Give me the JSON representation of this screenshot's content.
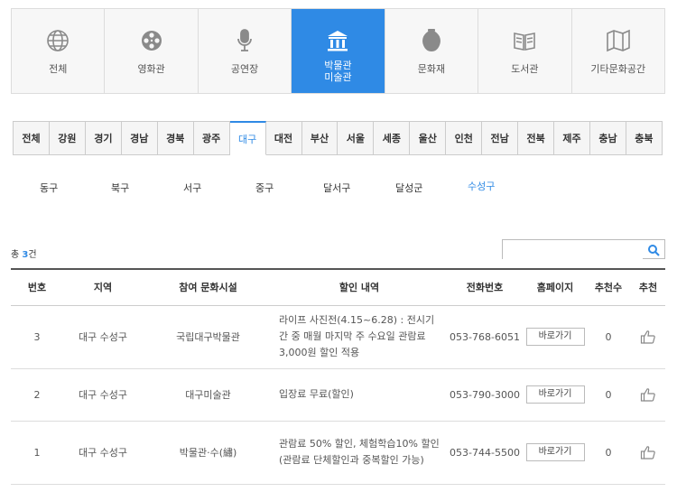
{
  "categories": [
    {
      "label": "전체",
      "icon": "globe-icon"
    },
    {
      "label": "영화관",
      "icon": "film-reel-icon"
    },
    {
      "label": "공연장",
      "icon": "microphone-icon"
    },
    {
      "label": "박물관\n미술관",
      "icon": "museum-icon",
      "active": true
    },
    {
      "label": "문화재",
      "icon": "vase-icon"
    },
    {
      "label": "도서관",
      "icon": "book-icon"
    },
    {
      "label": "기타문화공간",
      "icon": "map-icon"
    }
  ],
  "regions": [
    "전체",
    "강원",
    "경기",
    "경남",
    "경북",
    "광주",
    "대구",
    "대전",
    "부산",
    "서울",
    "세종",
    "울산",
    "인천",
    "전남",
    "전북",
    "제주",
    "충남",
    "충북"
  ],
  "active_region": "대구",
  "districts": [
    "동구",
    "북구",
    "서구",
    "중구",
    "달서구",
    "달성군",
    "수성구"
  ],
  "active_district": "수성구",
  "count": {
    "prefix": "총 ",
    "number": "3",
    "suffix": "건"
  },
  "search": {
    "placeholder": "",
    "value": ""
  },
  "table": {
    "headers": [
      "번호",
      "지역",
      "참여 문화시설",
      "할인 내역",
      "전화번호",
      "홈페이지",
      "추천수",
      "추천"
    ],
    "rows": [
      {
        "no": "3",
        "region": "대구 수성구",
        "facility": "국립대구박물관",
        "discount": "라이프 사진전(4.15~6.28) : 전시기간 중 매월 마지막 주 수요일 관람료 3,000원 할인 적용",
        "phone": "053-768-6051",
        "homepage": "바로가기",
        "recommend": "0"
      },
      {
        "no": "2",
        "region": "대구 수성구",
        "facility": "대구미술관",
        "discount": "입장료 무료(할인)",
        "phone": "053-790-3000",
        "homepage": "바로가기",
        "recommend": "0"
      },
      {
        "no": "1",
        "region": "대구 수성구",
        "facility": "박물관·수(繡)",
        "discount": "관람료 50% 할인, 체험학습10% 할인 (관람료 단체할인과 중복할인 가능)",
        "phone": "053-744-5500",
        "homepage": "바로가기",
        "recommend": "0"
      }
    ]
  },
  "colors": {
    "accent": "#2f8ae5",
    "icon_gray": "#8a8a8a"
  }
}
